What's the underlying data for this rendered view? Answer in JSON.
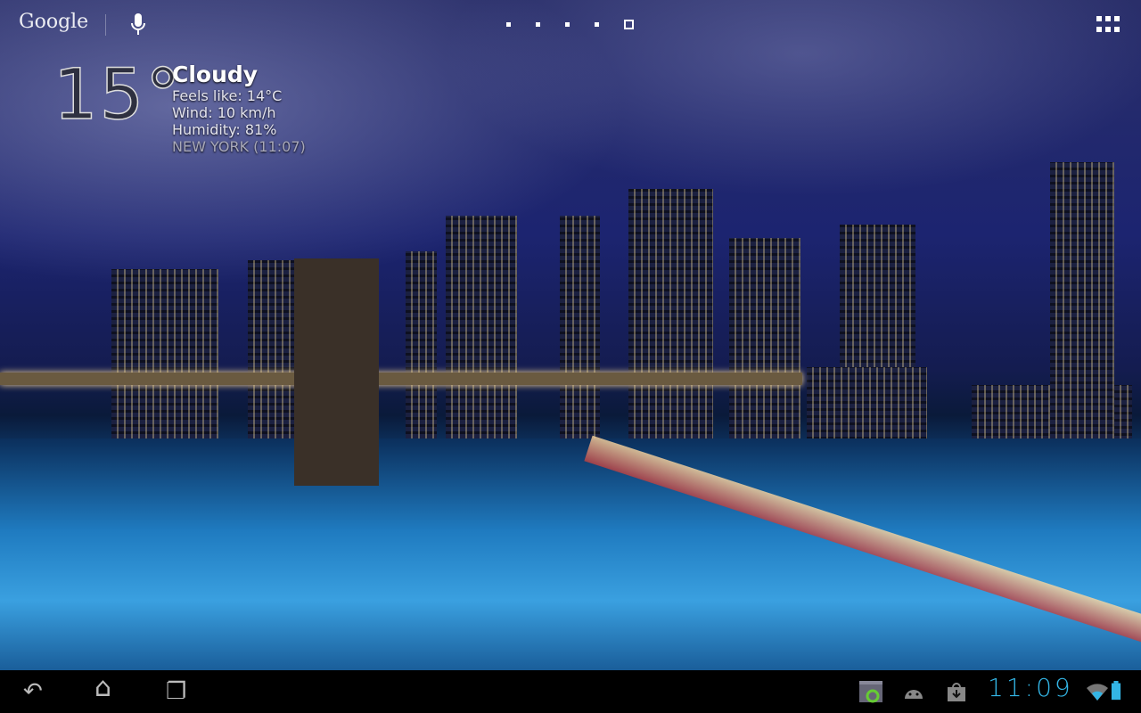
{
  "search": {
    "brand": "Google"
  },
  "weather": {
    "temperature": "15°",
    "condition": "Cloudy",
    "feels_like": "Feels like: 14°C",
    "wind": "Wind: 10 km/h",
    "humidity": "Humidity: 81%",
    "location": "NEW YORK (11:07)"
  },
  "home_pages": {
    "count": 5,
    "current": 5
  },
  "status": {
    "time": "11:09",
    "accent": "#33b5e5"
  },
  "nav": {
    "back": "↶",
    "home": "⌂",
    "recents": "❐"
  }
}
